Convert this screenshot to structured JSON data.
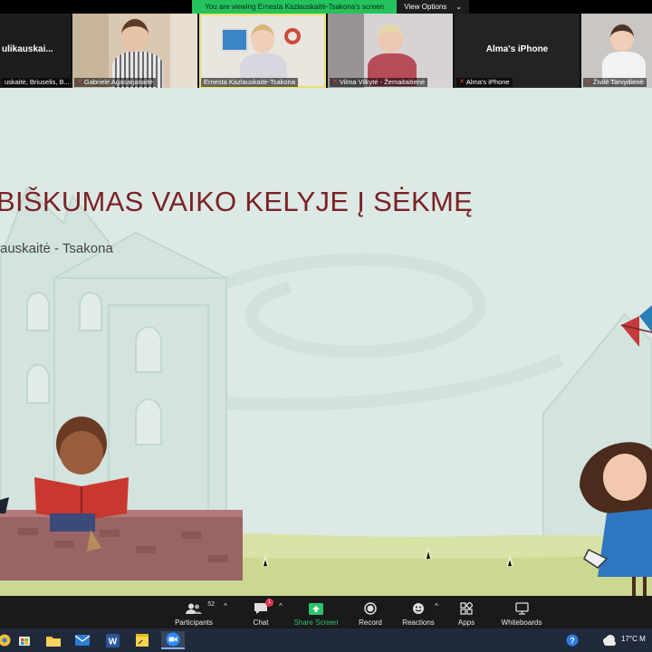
{
  "banner": {
    "text": "You are viewing Ernesta Kazlauskaitė-Tsakona's screen",
    "view_options": "View Options",
    "chevron": "⌄"
  },
  "participants": [
    {
      "big_name": "ulikauskai...",
      "label": "uskaitė, Briuselis, B...",
      "muted": false
    },
    {
      "big_name": "",
      "label": "Gabrielė Agasarjanaitė",
      "muted": true
    },
    {
      "big_name": "",
      "label": "Ernesta Kazlauskaitė-Tsakona",
      "muted": false,
      "active": true
    },
    {
      "big_name": "",
      "label": "Vilma Vilkytė - Žemaitaitienė",
      "muted": true
    },
    {
      "big_name": "Alma's iPhone",
      "label": "Alma's iPhone",
      "muted": true
    },
    {
      "big_name": "",
      "label": "Živilė Tarvydienė",
      "muted": true
    }
  ],
  "slide": {
    "title": "BIŠKUMAS VAIKO KELYJE Į SĖKMĘ",
    "subtitle": "auskaitė - Tsakona"
  },
  "toolbar": {
    "participants_label": "Participants",
    "participants_count": "52",
    "chat_label": "Chat",
    "chat_badge": "1",
    "share_label": "Share Screen",
    "record_label": "Record",
    "reactions_label": "Reactions",
    "apps_label": "Apps",
    "whiteboards_label": "Whiteboards",
    "caret": "^"
  },
  "taskbar": {
    "weather": "17°C  M",
    "icons": [
      "chrome-icon",
      "windows-store-icon",
      "file-explorer-icon",
      "mail-icon",
      "word-icon",
      "sticky-notes-icon",
      "zoom-icon"
    ],
    "active_icon": "zoom-icon"
  },
  "colors": {
    "slide_bg": "#dde9e5",
    "title": "#7a2226",
    "share_green": "#2ec36a",
    "banner_green": "#24c25c"
  }
}
